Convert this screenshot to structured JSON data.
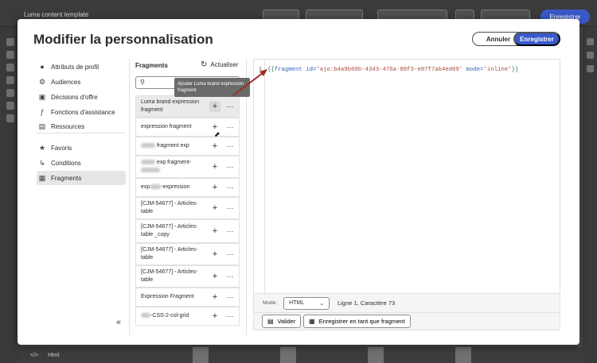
{
  "background": {
    "doc_title": "Luma content template",
    "publish_label": "Enregistrer",
    "bottom_row": "Html"
  },
  "modal": {
    "title": "Modifier la personnalisation",
    "cancel_label": "Annuler",
    "save_label": "Enregistrer"
  },
  "nav": {
    "items": [
      {
        "label": "Attributs de profil",
        "icon": "person-icon"
      },
      {
        "label": "Audiences",
        "icon": "audience-icon"
      },
      {
        "label": "Décisions d'offre",
        "icon": "offer-decision-icon"
      },
      {
        "label": "Fonctions d'assistance",
        "icon": "function-icon"
      },
      {
        "label": "Ressources",
        "icon": "image-icon"
      },
      {
        "label": "Favoris",
        "icon": "star-icon"
      },
      {
        "label": "Conditions",
        "icon": "conditions-icon"
      },
      {
        "label": "Fragments",
        "icon": "fragment-icon"
      }
    ],
    "active": "Fragments"
  },
  "fragments": {
    "title": "Fragments",
    "refresh_label": "Actualiser",
    "search_placeholder": "",
    "items": [
      {
        "line1": "Luma brand expression",
        "line2": "fragment"
      },
      {
        "line1": "expression fragment",
        "line2": ""
      },
      {
        "line1": "fragment exp",
        "line2": ""
      },
      {
        "line1": "exp fragment-",
        "line2": ""
      },
      {
        "line1": "exp",
        "line2": "-expression"
      },
      {
        "line1": "[CJM-54677] - Articles-",
        "line2": "table"
      },
      {
        "line1": "[CJM-54677] - Articles-",
        "line2": "table _copy"
      },
      {
        "line1": "[CJM-54677] - Articles-",
        "line2": "table"
      },
      {
        "line1": "[CJM-54677] - Articles-",
        "line2": "table"
      },
      {
        "line1": "Expression Fragment",
        "line2": ""
      },
      {
        "line1": "-CSS-2-col-grid",
        "line2": ""
      }
    ],
    "tooltip": "Ajouter Luma brand expression fragment"
  },
  "editor": {
    "line_number": "1",
    "code_open": "{{",
    "code_kw": "fragment",
    "code_attr1": "id=",
    "code_val1": "'ajo:b4a9b60b-4343-476a-88f3-e87f7ab4ed09'",
    "code_attr2": "mode=",
    "code_val2": "'inline'",
    "code_close": "}}",
    "mode_label": "Mode:",
    "mode_value": "HTML",
    "cursor_position": "Ligne 1, Caractère 73",
    "validate_label": "Valider",
    "save_fragment_label": "Enregistrer en tant que fragment"
  }
}
